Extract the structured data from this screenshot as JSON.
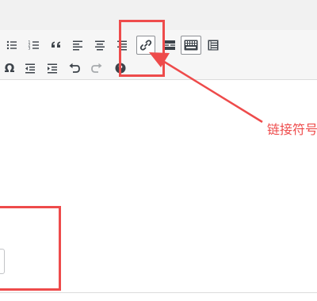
{
  "toolbar": {
    "row1": [
      {
        "name": "bullet-list-icon"
      },
      {
        "name": "numbered-list-icon"
      },
      {
        "name": "blockquote-icon"
      },
      {
        "name": "align-left-icon"
      },
      {
        "name": "align-center-icon"
      },
      {
        "name": "align-right-icon"
      },
      {
        "name": "link-icon",
        "active": true
      },
      {
        "name": "read-more-icon"
      },
      {
        "name": "keyboard-icon"
      },
      {
        "name": "table-icon"
      }
    ],
    "row2": [
      {
        "name": "special-char-icon",
        "glyph": "Ω"
      },
      {
        "name": "outdent-icon"
      },
      {
        "name": "indent-icon"
      },
      {
        "name": "undo-icon"
      },
      {
        "name": "redo-icon"
      },
      {
        "name": "help-icon"
      }
    ]
  },
  "annotation": {
    "label": "链接符号",
    "color": "#ee4b4b"
  }
}
